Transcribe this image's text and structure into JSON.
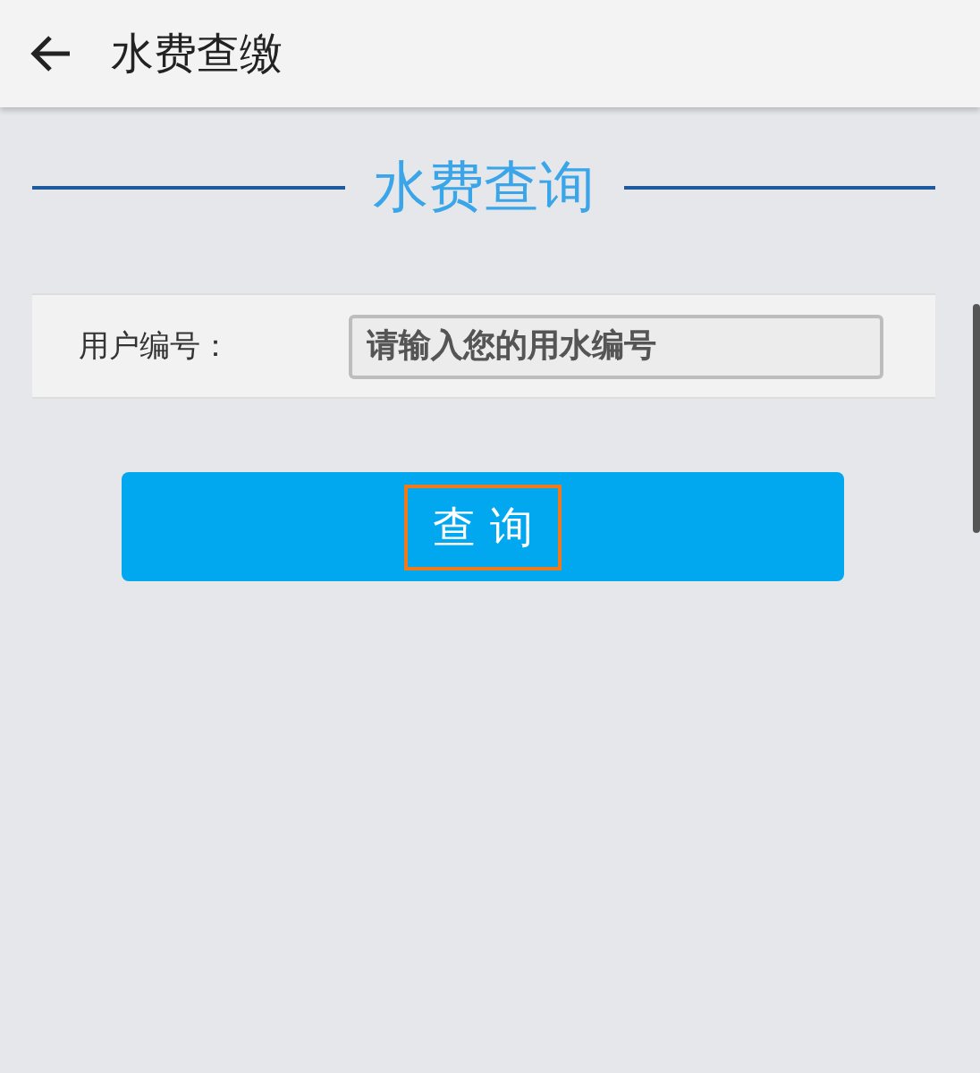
{
  "header": {
    "title": "水费查缴"
  },
  "section_title": "水费查询",
  "form": {
    "label": "用户编号：",
    "placeholder": "请输入您的用水编号"
  },
  "button": {
    "label": "查 询",
    "highlighted": true
  }
}
